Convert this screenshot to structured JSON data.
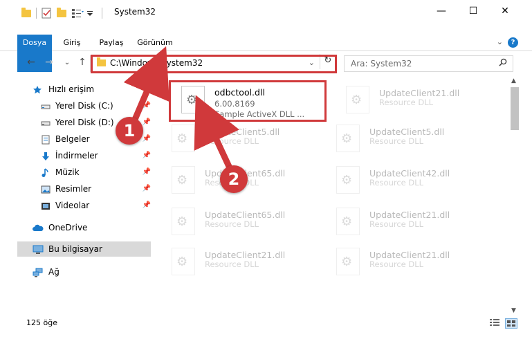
{
  "window": {
    "title": "System32",
    "caption": {
      "minimize": "—",
      "maximize": "☐",
      "close": "✕"
    }
  },
  "ribbon": {
    "tabs": [
      "Dosya",
      "Giriş",
      "Paylaş",
      "Görünüm"
    ],
    "help": "?"
  },
  "nav": {
    "address": "C:\\Windows\\System32",
    "search_placeholder": "Ara: System32"
  },
  "sidebar": {
    "items": [
      {
        "label": "Hızlı erişim",
        "icon": "star-icon"
      },
      {
        "label": "Yerel Disk (C:)",
        "icon": "drive-icon"
      },
      {
        "label": "Yerel Disk (D:)",
        "icon": "drive-icon"
      },
      {
        "label": "Belgeler",
        "icon": "document-icon"
      },
      {
        "label": "İndirmeler",
        "icon": "download-icon"
      },
      {
        "label": "Müzik",
        "icon": "music-icon"
      },
      {
        "label": "Resimler",
        "icon": "pictures-icon"
      },
      {
        "label": "Videolar",
        "icon": "video-icon"
      },
      {
        "label": "OneDrive",
        "icon": "cloud-icon"
      },
      {
        "label": "Bu bilgisayar",
        "icon": "computer-icon"
      },
      {
        "label": "Ağ",
        "icon": "network-icon"
      }
    ]
  },
  "files": [
    {
      "name": "odbctool.dll",
      "line1": "6.00.8169",
      "line2": "Sample ActiveX DLL ..."
    },
    {
      "name": "UpdateClient21.dll",
      "line1": "Resource DLL"
    },
    {
      "name": "UpdateClient5.dll",
      "line1": "Resource DLL"
    },
    {
      "name": "UpdateClient5.dll",
      "line1": "Resource DLL"
    },
    {
      "name": "UpdateClient65.dll",
      "line1": "Resource DLL"
    },
    {
      "name": "UpdateClient42.dll",
      "line1": "Resource DLL"
    },
    {
      "name": "UpdateClient65.dll",
      "line1": "Resource DLL"
    },
    {
      "name": "UpdateClient21.dll",
      "line1": "Resource DLL"
    },
    {
      "name": "UpdateClient21.dll",
      "line1": "Resource DLL"
    },
    {
      "name": "UpdateClient21.dll",
      "line1": "Resource DLL"
    }
  ],
  "status": {
    "count": "125 öğe"
  },
  "annotations": {
    "marker1": "1",
    "marker2": "2",
    "color": "#d0393b"
  },
  "colors": {
    "accent": "#1979ca",
    "folder": "#f4c440"
  }
}
